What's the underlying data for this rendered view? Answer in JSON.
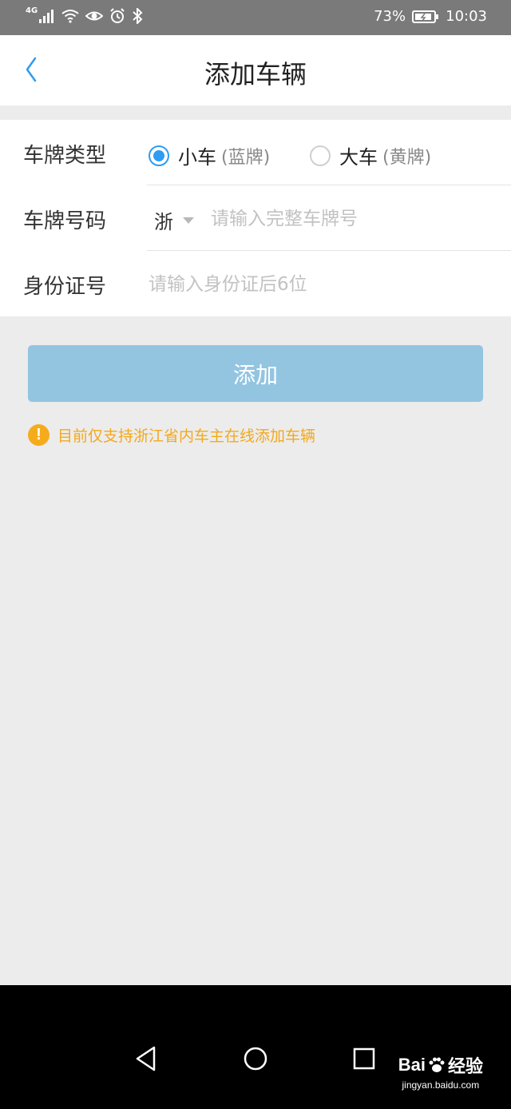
{
  "status_bar": {
    "network": "4G",
    "battery": "73%",
    "time": "10:03"
  },
  "header": {
    "title": "添加车辆",
    "back_icon": "chevron-left-icon"
  },
  "form": {
    "plate_type": {
      "label": "车牌类型",
      "options": [
        {
          "label": "小车",
          "sub": "(蓝牌)",
          "checked": true
        },
        {
          "label": "大车",
          "sub": "(黄牌)",
          "checked": false
        }
      ]
    },
    "plate_number": {
      "label": "车牌号码",
      "province": "浙",
      "placeholder": "请输入完整车牌号"
    },
    "id_number": {
      "label": "身份证号",
      "placeholder": "请输入身份证后6位"
    }
  },
  "add_button": {
    "label": "添加"
  },
  "notice": {
    "icon": "!",
    "text": "目前仅支持浙江省内车主在线添加车辆"
  },
  "watermark": {
    "brand": "Bai",
    "brand_suffix": "经验",
    "url": "jingyan.baidu.com"
  },
  "colors": {
    "accent": "#2e9cf2",
    "button": "#93c5e1",
    "warning": "#f5ac1c"
  }
}
